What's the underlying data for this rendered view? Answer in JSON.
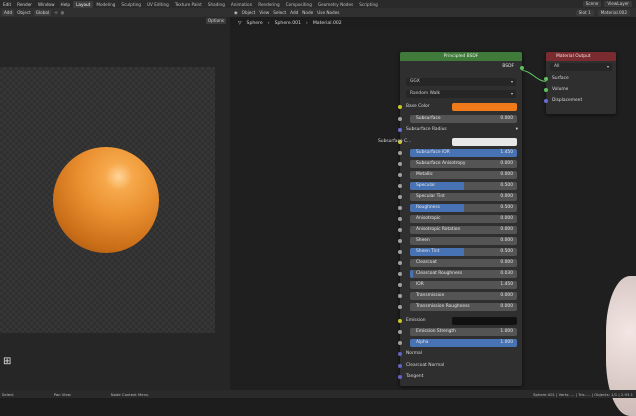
{
  "topbar": {
    "menus": [
      "Edit",
      "Render",
      "Window",
      "Help"
    ],
    "workspaces": [
      "Layout",
      "Modeling",
      "Sculpting",
      "UV Editing",
      "Texture Paint",
      "Shading",
      "Animation",
      "Rendering",
      "Compositing",
      "Geometry Nodes",
      "Scripting"
    ],
    "active_workspace": "Layout",
    "scene_field": "Scene",
    "layer_field": "ViewLayer"
  },
  "viewport": {
    "header_items": [
      "Add",
      "Object",
      "Global"
    ],
    "options_label": "Options"
  },
  "node_editor": {
    "header_items": [
      "Object",
      "View",
      "Select",
      "Add",
      "Node",
      "Use Nodes"
    ],
    "slot_field": "Slot 1",
    "material_field": "Material.002",
    "breadcrumb": [
      "Sphere",
      "Sphere.001",
      "Material.002"
    ]
  },
  "principled": {
    "title": "Principled BSDF",
    "output_label": "BSDF",
    "distribution": "GGX",
    "subsurface_method": "Random Walk",
    "base_color_label": "Base Color",
    "base_color": "#f07a1a",
    "subsurface_label": "Subsurface",
    "subsurface_value": "0.000",
    "subsurface_radius_label": "Subsurface Radius",
    "subsurface_color_label": "Subsurface C...",
    "subsurface_color": "#e8e8e8",
    "fields": [
      {
        "label": "Subsurface IOR",
        "value": "1.450",
        "fill": 1.0
      },
      {
        "label": "Subsurface Anisotropy",
        "value": "0.000",
        "fill": 0.0
      },
      {
        "label": "Metallic",
        "value": "0.000",
        "fill": 0.0
      },
      {
        "label": "Specular",
        "value": "0.500",
        "fill": 0.5
      },
      {
        "label": "Specular Tint",
        "value": "0.000",
        "fill": 0.0
      },
      {
        "label": "Roughness",
        "value": "0.500",
        "fill": 0.5
      },
      {
        "label": "Anisotropic",
        "value": "0.000",
        "fill": 0.0
      },
      {
        "label": "Anisotropic Rotation",
        "value": "0.000",
        "fill": 0.0
      },
      {
        "label": "Sheen",
        "value": "0.000",
        "fill": 0.0
      },
      {
        "label": "Sheen Tint",
        "value": "0.500",
        "fill": 0.5
      },
      {
        "label": "Clearcoat",
        "value": "0.000",
        "fill": 0.0
      },
      {
        "label": "Clearcoat Roughness",
        "value": "0.030",
        "fill": 0.03
      },
      {
        "label": "IOR",
        "value": "1.450",
        "fill": 0.0
      },
      {
        "label": "Transmission",
        "value": "0.000",
        "fill": 0.0
      },
      {
        "label": "Transmission Roughness",
        "value": "0.000",
        "fill": 0.0
      }
    ],
    "emission_label": "Emission",
    "emission_color": "#111111",
    "emission_strength_label": "Emission Strength",
    "emission_strength_value": "1.000",
    "alpha_label": "Alpha",
    "alpha_value": "1.000",
    "normal_label": "Normal",
    "clearcoat_normal_label": "Clearcoat Normal",
    "tangent_label": "Tangent"
  },
  "material_output": {
    "title": "Material Output",
    "target": "All",
    "inputs": [
      "Surface",
      "Volume",
      "Displacement"
    ]
  },
  "statusbar": {
    "left": "Select",
    "middle": "Pan View",
    "middle2": "Node Context Menu",
    "right": "Sphere.001 | Verts: ... | Tris: ... | Objects: 1/1 | 2.93.1"
  }
}
